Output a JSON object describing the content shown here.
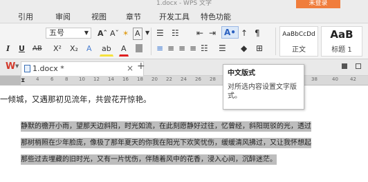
{
  "titlebar": {
    "title": "1.docx - WPS 文字",
    "orange_button": "未登录"
  },
  "menu": [
    "引用",
    "审阅",
    "视图",
    "章节",
    "开发工具",
    "特色功能"
  ],
  "ribbon": {
    "font_size": "五号",
    "grow_font": "Aˆ",
    "shrink_font": "Aˇ",
    "clear_format": "✶",
    "font_box": "A",
    "char_spacing": "↑",
    "italic": "I",
    "underline": "U",
    "strike": "AB",
    "superscript": "X²",
    "subscript": "X₂",
    "text_effect": "A",
    "highlight": "ab",
    "font_color": "A",
    "styles": [
      {
        "sample": "AaBbCcDd",
        "label": "正文"
      },
      {
        "sample": "AaB",
        "label": "标题 1"
      }
    ]
  },
  "document_tab": {
    "name": "1.docx *",
    "close": "×",
    "new_tab": "+"
  },
  "ruler_numbers": [
    "4",
    "6",
    "8",
    "10",
    "12",
    "14",
    "16",
    "18",
    "20",
    "22",
    "24",
    "26",
    "28",
    "30",
    "32",
    "34",
    "36",
    "38",
    "40",
    "42"
  ],
  "tooltip": {
    "title": "中文版式",
    "description": "对所选内容设置文字版式。"
  },
  "document": {
    "line1": "一倾城，又遇那初见流年，共尝花开惊艳。",
    "shaded_lines": [
      "静默的檐开小雨，望那天边斜阳，时光如流，在此刻愿静好过往，忆曾经，斜阳斑驳的光，透过",
      "那树梢照在少年脸庞，像极了那年夏天的你我在阳光下欢笑忧伤，缓缓清风拂过，又让我怀想起",
      "那些过去埋藏的旧时光，又有一片忧伤，伴随着风中的花香，浸入心间，沉醉迷茫。"
    ]
  },
  "colors": {
    "accent": "#f07d3c",
    "shade": "#bdbdbd",
    "wps_red": "#d33a2c"
  }
}
